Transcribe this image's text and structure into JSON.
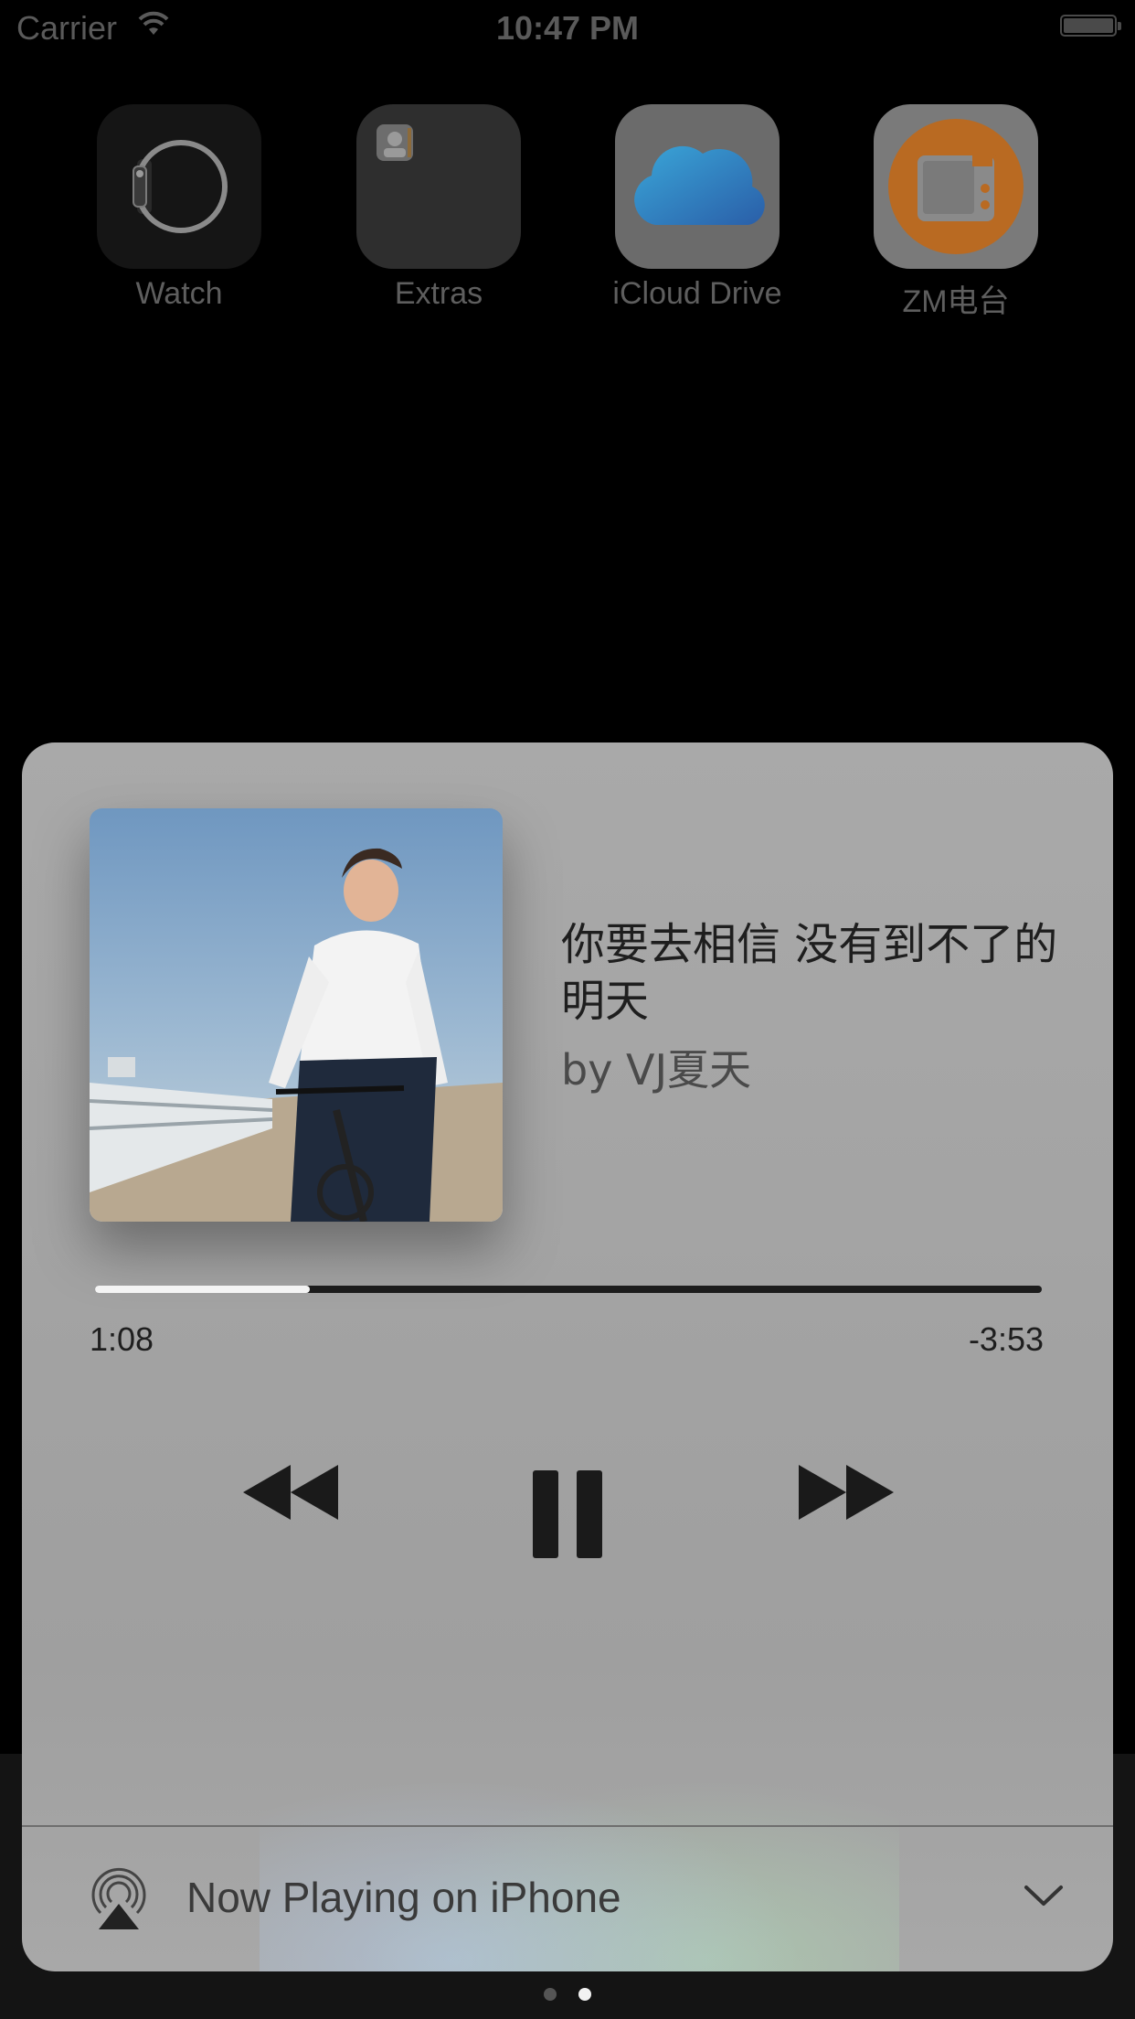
{
  "status_bar": {
    "carrier": "Carrier",
    "time": "10:47 PM"
  },
  "home_apps": [
    {
      "label": "Watch",
      "icon": "watch-icon"
    },
    {
      "label": "Extras",
      "icon": "folder-icon"
    },
    {
      "label": "iCloud Drive",
      "icon": "cloud-icon"
    },
    {
      "label": "ZM电台",
      "icon": "radio-icon"
    }
  ],
  "now_playing": {
    "title": "你要去相信 没有到不了的明天",
    "artist": "by VJ夏天",
    "elapsed": "1:08",
    "remaining": "-3:53",
    "progress_fraction": 0.227,
    "controls": [
      "rewind-icon",
      "pause-icon",
      "fast-forward-icon"
    ],
    "output_label": "Now Playing on iPhone"
  },
  "pager": {
    "page_count": 2,
    "current_page": 2
  },
  "colors": {
    "card_background": "#a6a6a6",
    "progress_fill": "#f4f4f4",
    "progress_track": "#1c1c1c",
    "radio_orange": "#d2741c",
    "cloud_blue": "#3a8fd6"
  }
}
